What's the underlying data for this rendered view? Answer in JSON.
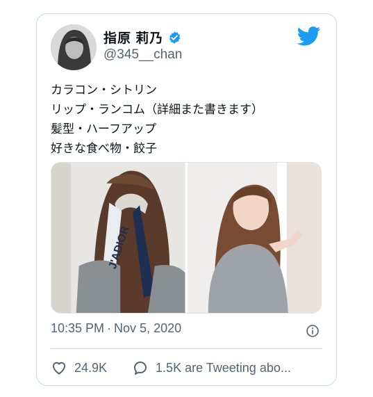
{
  "tweet": {
    "display_name": "指原 莉乃",
    "handle": "@345__chan",
    "lines": [
      "カラコン・シトリン",
      "リップ・ランコム（詳細また書きます）",
      "髪型・ハーフアップ",
      "好きな食べ物・餃子"
    ],
    "media_text": "J'ADIOR",
    "time": "10:35 PM",
    "separator": "·",
    "date": "Nov 5, 2020",
    "likes": "24.9K",
    "tweeting": "1.5K are Tweeting abo..."
  },
  "colors": {
    "accent": "#1d9bf0",
    "text": "#0f1419",
    "muted": "#536471",
    "border": "#cfd9de"
  },
  "icons": [
    "verified-badge-icon",
    "twitter-bird-icon",
    "info-icon",
    "heart-icon",
    "speech-bubble-icon"
  ]
}
